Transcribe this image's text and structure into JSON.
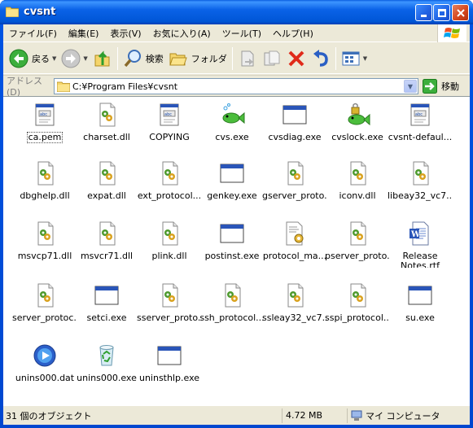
{
  "window": {
    "title": "cvsnt",
    "minimize": "_",
    "maximize": "□",
    "close": "X"
  },
  "menu": [
    "ファイル(F)",
    "編集(E)",
    "表示(V)",
    "お気に入り(A)",
    "ツール(T)",
    "ヘルプ(H)"
  ],
  "toolbar": {
    "back_label": "戻る",
    "search_label": "検索",
    "folders_label": "フォルダ"
  },
  "address": {
    "label": "アドレス(D)",
    "value": "C:¥Program Files¥cvsnt",
    "go_label": "移動"
  },
  "files": [
    {
      "name": "ca.pem",
      "icon": "text-file-icon"
    },
    {
      "name": "charset.dll",
      "icon": "dll-icon"
    },
    {
      "name": "COPYING",
      "icon": "text-file-icon"
    },
    {
      "name": "cvs.exe",
      "icon": "fish-icon"
    },
    {
      "name": "cvsdiag.exe",
      "icon": "window-exe-icon"
    },
    {
      "name": "cvslock.exe",
      "icon": "lock-fish-icon"
    },
    {
      "name": "cvsnt-defaul...",
      "icon": "text-file-icon"
    },
    {
      "name": "dbghelp.dll",
      "icon": "dll-icon"
    },
    {
      "name": "expat.dll",
      "icon": "dll-icon"
    },
    {
      "name": "ext_protocol...",
      "icon": "dll-icon"
    },
    {
      "name": "genkey.exe",
      "icon": "window-exe-icon"
    },
    {
      "name": "gserver_proto...",
      "icon": "dll-icon"
    },
    {
      "name": "iconv.dll",
      "icon": "dll-icon"
    },
    {
      "name": "libeay32_vc7...",
      "icon": "dll-icon"
    },
    {
      "name": "msvcp71.dll",
      "icon": "dll-icon"
    },
    {
      "name": "msvcr71.dll",
      "icon": "dll-icon"
    },
    {
      "name": "plink.dll",
      "icon": "dll-icon"
    },
    {
      "name": "postinst.exe",
      "icon": "window-exe-icon"
    },
    {
      "name": "protocol_ma...",
      "icon": "config-file-icon"
    },
    {
      "name": "pserver_proto...",
      "icon": "dll-icon"
    },
    {
      "name": "Release Notes.rtf",
      "icon": "word-doc-icon"
    },
    {
      "name": "server_protoc...",
      "icon": "dll-icon"
    },
    {
      "name": "setci.exe",
      "icon": "window-exe-icon"
    },
    {
      "name": "sserver_proto...",
      "icon": "dll-icon"
    },
    {
      "name": "ssh_protocol...",
      "icon": "dll-icon"
    },
    {
      "name": "ssleay32_vc7...",
      "icon": "dll-icon"
    },
    {
      "name": "sspi_protocol...",
      "icon": "dll-icon"
    },
    {
      "name": "su.exe",
      "icon": "window-exe-icon"
    },
    {
      "name": "unins000.dat",
      "icon": "media-file-icon"
    },
    {
      "name": "unins000.exe",
      "icon": "recycle-icon"
    },
    {
      "name": "uninsthlp.exe",
      "icon": "window-exe-icon"
    }
  ],
  "status": {
    "count": "31 個のオブジェクト",
    "size": "4.72 MB",
    "location": "マイ コンピュータ"
  }
}
